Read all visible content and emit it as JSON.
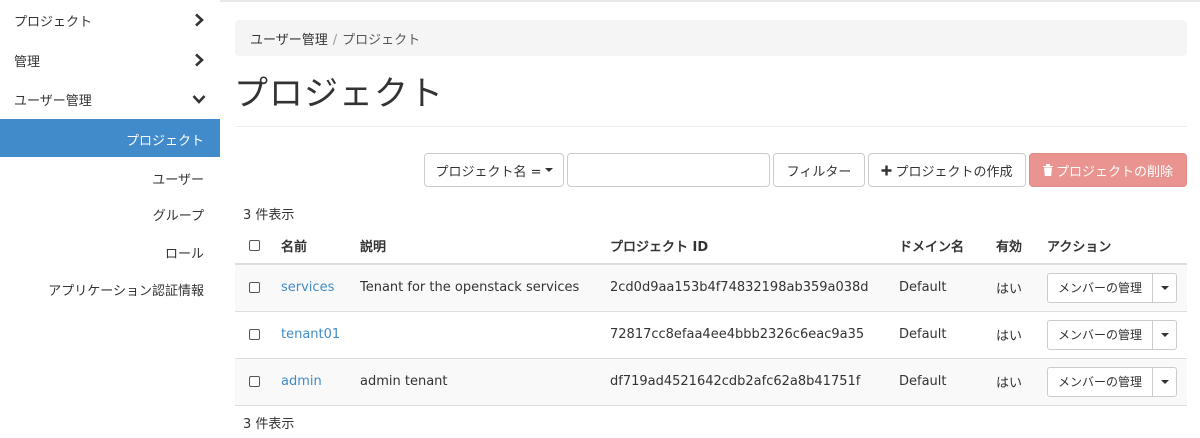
{
  "sidebar": {
    "items": [
      {
        "label": "プロジェクト",
        "icon": "chevron-right-icon"
      },
      {
        "label": "管理",
        "icon": "chevron-right-icon"
      },
      {
        "label": "ユーザー管理",
        "icon": "chevron-down-icon"
      }
    ],
    "sub_items": [
      {
        "label": "プロジェクト",
        "active": true
      },
      {
        "label": "ユーザー",
        "active": false
      },
      {
        "label": "グループ",
        "active": false
      },
      {
        "label": "ロール",
        "active": false
      },
      {
        "label": "アプリケーション認証情報",
        "active": false
      }
    ]
  },
  "breadcrumb": {
    "parent": "ユーザー管理",
    "separator": "/",
    "current": "プロジェクト"
  },
  "page": {
    "title": "プロジェクト"
  },
  "toolbar": {
    "filter_field_label": "プロジェクト名 =",
    "filter_input_value": "",
    "filter_button": "フィルター",
    "create_button": "プロジェクトの作成",
    "delete_button": "プロジェクトの削除"
  },
  "summary": {
    "top": "3 件表示",
    "bottom": "3 件表示"
  },
  "table": {
    "headers": {
      "name": "名前",
      "description": "説明",
      "project_id": "プロジェクト ID",
      "domain": "ドメイン名",
      "enabled": "有効",
      "actions": "アクション"
    },
    "rows": [
      {
        "name": "services",
        "description": "Tenant for the openstack services",
        "project_id": "2cd0d9aa153b4f74832198ab359a038d",
        "domain": "Default",
        "enabled": "はい",
        "action": "メンバーの管理"
      },
      {
        "name": "tenant01",
        "description": "",
        "project_id": "72817cc8efaa4ee4bbb2326c6eac9a35",
        "domain": "Default",
        "enabled": "はい",
        "action": "メンバーの管理"
      },
      {
        "name": "admin",
        "description": "admin tenant",
        "project_id": "df719ad4521642cdb2afc62a8b41751f",
        "domain": "Default",
        "enabled": "はい",
        "action": "メンバーの管理"
      }
    ]
  },
  "colors": {
    "accent": "#428bca",
    "danger": "#e99490",
    "breadcrumb_bg": "#f5f5f5"
  }
}
